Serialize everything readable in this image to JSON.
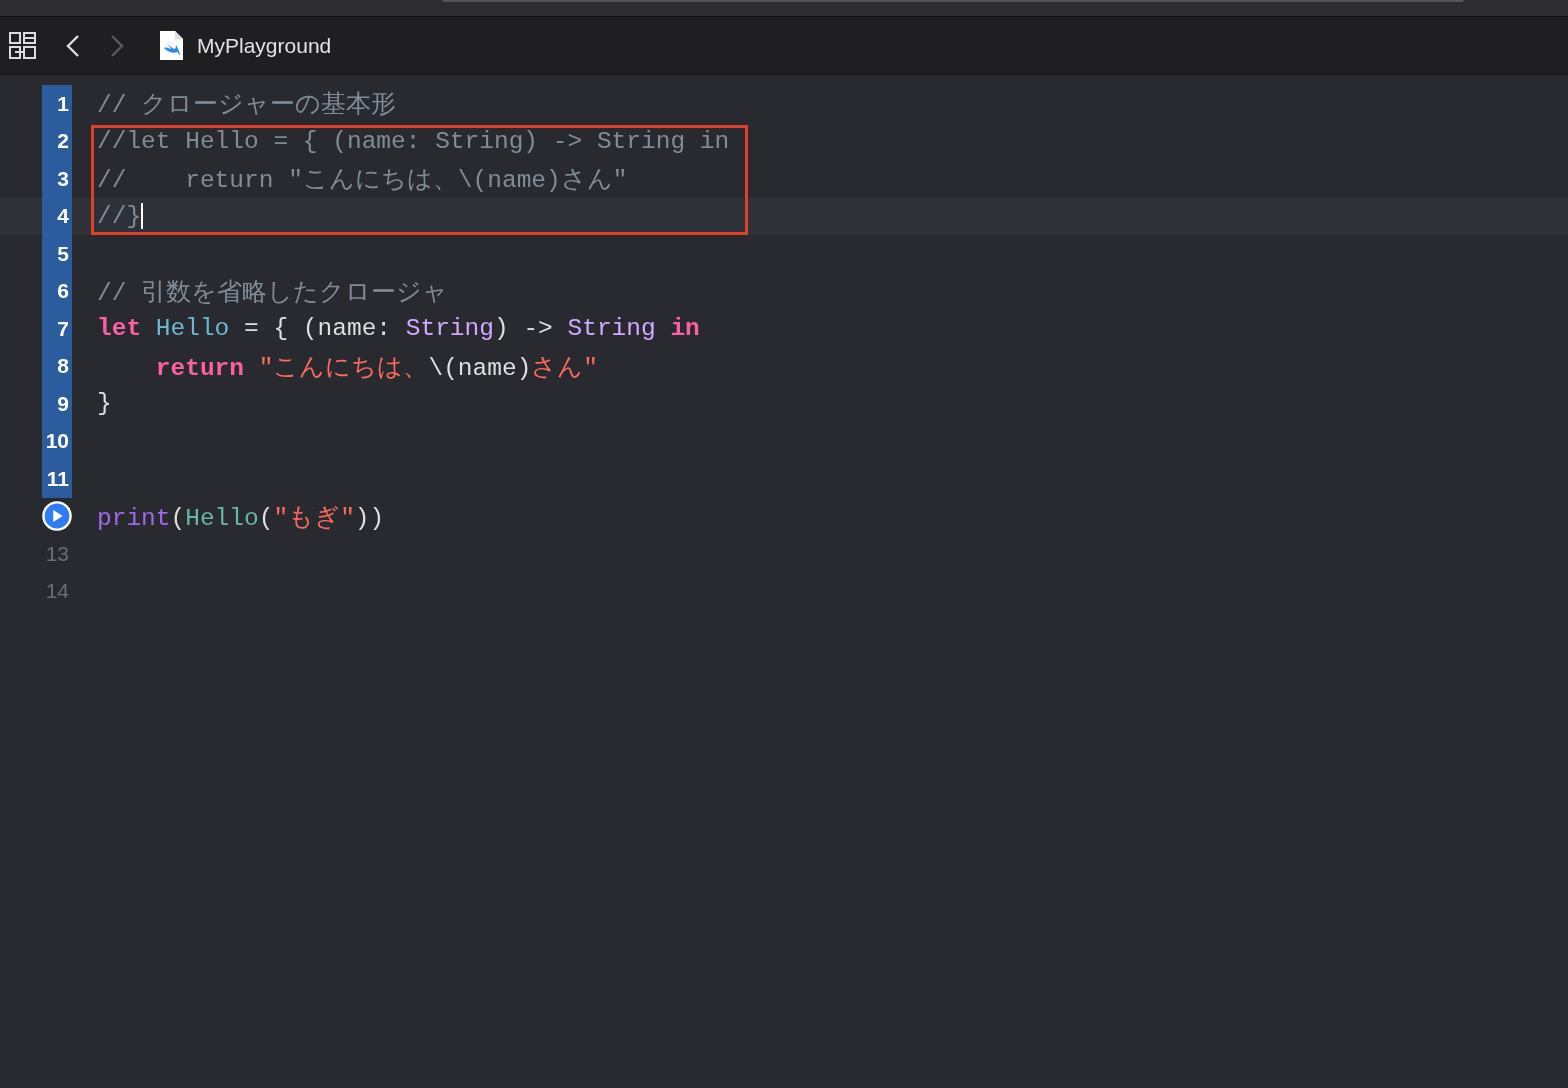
{
  "toolbar": {
    "back_enabled": true,
    "forward_enabled": false,
    "file_name": "MyPlayground"
  },
  "editor": {
    "lines": [
      {
        "number": "1",
        "executed": true,
        "current": false,
        "boxed": false,
        "tokens": [
          {
            "kind": "comment",
            "text": "// クロージャーの基本形"
          }
        ]
      },
      {
        "number": "2",
        "executed": true,
        "current": false,
        "boxed": true,
        "tokens": [
          {
            "kind": "comment",
            "text": "//let Hello = { (name: String) -> String in"
          }
        ]
      },
      {
        "number": "3",
        "executed": true,
        "current": false,
        "boxed": true,
        "tokens": [
          {
            "kind": "comment",
            "text": "//    return \"こんにちは、\\(name)さん\""
          }
        ]
      },
      {
        "number": "4",
        "executed": true,
        "current": true,
        "boxed": true,
        "tokens": [
          {
            "kind": "comment",
            "text": "//}"
          }
        ]
      },
      {
        "number": "5",
        "executed": true,
        "current": false,
        "boxed": false
      },
      {
        "number": "6",
        "executed": true,
        "current": false,
        "boxed": false,
        "tokens": [
          {
            "kind": "comment",
            "text": "// 引数を省略したクロージャ"
          }
        ]
      },
      {
        "number": "7",
        "executed": true,
        "current": false,
        "boxed": false,
        "tokens": [
          {
            "kind": "keyword",
            "text": "let"
          },
          {
            "kind": "ident",
            "text": " Hello"
          },
          {
            "kind": "plain",
            "text": " = { (name: "
          },
          {
            "kind": "type",
            "text": "String"
          },
          {
            "kind": "plain",
            "text": ") -> "
          },
          {
            "kind": "type",
            "text": "String"
          },
          {
            "kind": "keyword",
            "text": " in"
          }
        ]
      },
      {
        "number": "8",
        "executed": true,
        "current": false,
        "boxed": false,
        "tokens": [
          {
            "kind": "keyword",
            "text": "    return"
          },
          {
            "kind": "string",
            "text": " \"こんにちは、"
          },
          {
            "kind": "plain",
            "text": "\\(name)"
          },
          {
            "kind": "string",
            "text": "さん\""
          }
        ]
      },
      {
        "number": "9",
        "executed": true,
        "current": false,
        "boxed": false,
        "tokens": [
          {
            "kind": "plain",
            "text": "}"
          }
        ]
      },
      {
        "number": "10",
        "executed": true,
        "current": false,
        "boxed": false
      },
      {
        "number": "11",
        "executed": true,
        "current": false,
        "boxed": false
      },
      {
        "run_button": true,
        "current": false,
        "boxed": false,
        "tokens": [
          {
            "kind": "func",
            "text": "print"
          },
          {
            "kind": "plain",
            "text": "("
          },
          {
            "kind": "call",
            "text": "Hello"
          },
          {
            "kind": "plain",
            "text": "("
          },
          {
            "kind": "string",
            "text": "\"もぎ\""
          },
          {
            "kind": "plain",
            "text": "))"
          }
        ]
      },
      {
        "number": "13",
        "executed": false,
        "current": false,
        "boxed": false
      },
      {
        "number": "14",
        "executed": false,
        "current": false,
        "boxed": false
      }
    ]
  }
}
